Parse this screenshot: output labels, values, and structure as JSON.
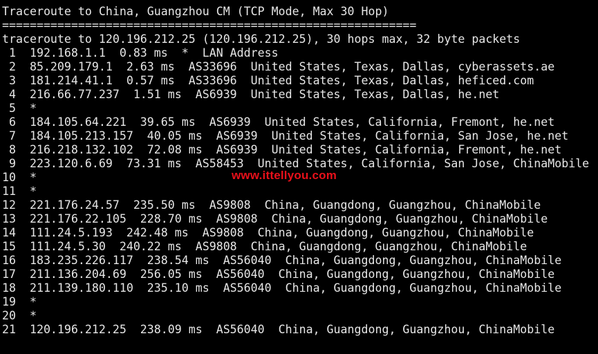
{
  "terminal": {
    "lines": [
      "Traceroute to China, Guangzhou CM (TCP Mode, Max 30 Hop)",
      "============================================================",
      "traceroute to 120.196.212.25 (120.196.212.25), 30 hops max, 32 byte packets",
      " 1  192.168.1.1  0.83 ms  *  LAN Address",
      " 2  85.209.179.1  2.63 ms  AS33696  United States, Texas, Dallas, cyberassets.ae",
      " 3  181.214.41.1  0.57 ms  AS33696  United States, Texas, Dallas, heficed.com",
      " 4  216.66.77.237  1.51 ms  AS6939  United States, Texas, Dallas, he.net",
      " 5  *",
      " 6  184.105.64.221  39.65 ms  AS6939  United States, California, Fremont, he.net",
      " 7  184.105.213.157  40.05 ms  AS6939  United States, California, San Jose, he.net",
      " 8  216.218.132.102  72.08 ms  AS6939  United States, California, Fremont, he.net",
      " 9  223.120.6.69  73.31 ms  AS58453  United States, California, San Jose, ChinaMobile",
      "10  *",
      "11  *",
      "12  221.176.24.57  235.50 ms  AS9808  China, Guangdong, Guangzhou, ChinaMobile",
      "13  221.176.22.105  228.70 ms  AS9808  China, Guangdong, Guangzhou, ChinaMobile",
      "14  111.24.5.193  242.48 ms  AS9808  China, Guangdong, Guangzhou, ChinaMobile",
      "15  111.24.5.30  240.22 ms  AS9808  China, Guangdong, Guangzhou, ChinaMobile",
      "16  183.235.226.117  238.54 ms  AS56040  China, Guangdong, Guangzhou, ChinaMobile",
      "17  211.136.204.69  256.05 ms  AS56040  China, Guangdong, Guangzhou, ChinaMobile",
      "18  211.139.180.110  235.10 ms  AS56040  China, Guangdong, Guangzhou, ChinaMobile",
      "19  *",
      "20  *",
      "21  120.196.212.25  238.09 ms  AS56040  China, Guangdong, Guangzhou, ChinaMobile"
    ]
  },
  "watermark": {
    "text": "www.ittellyou.com",
    "color": "#e8101a"
  },
  "colors": {
    "background": "#000000",
    "foreground": "#e6e6e6"
  }
}
